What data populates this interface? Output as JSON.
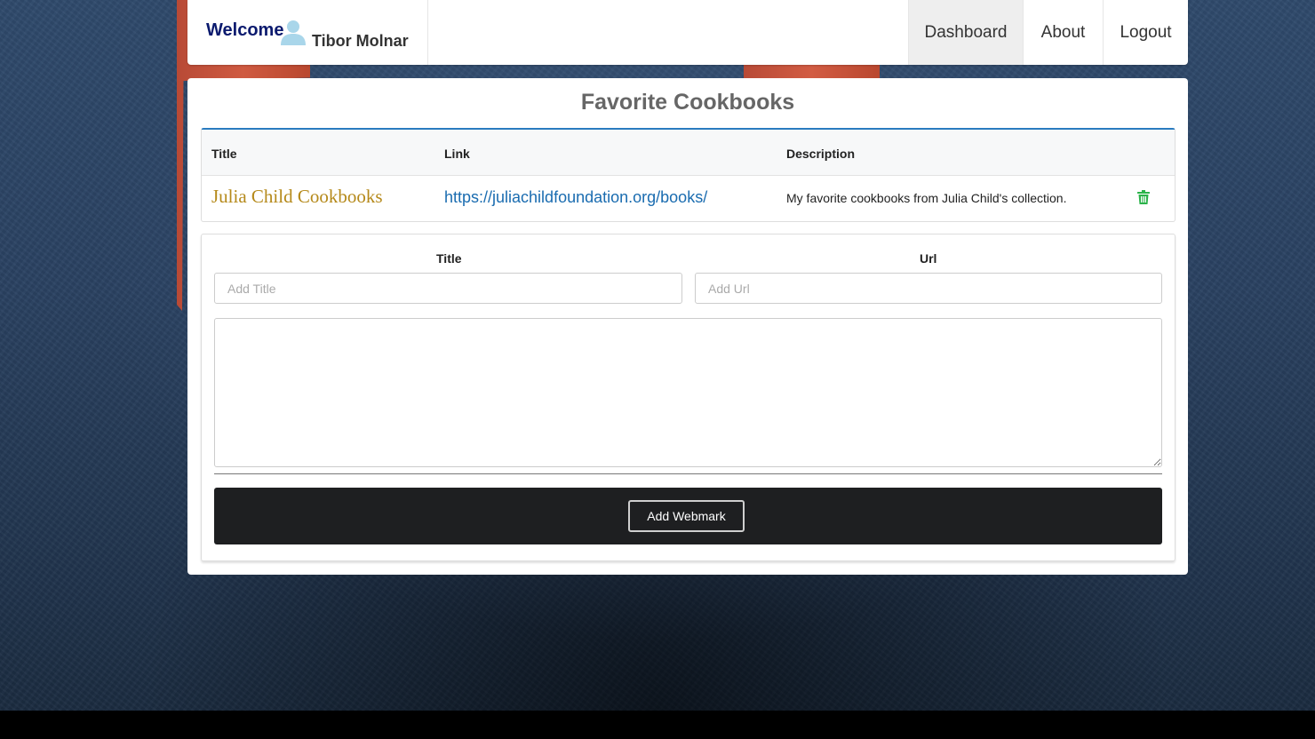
{
  "header": {
    "welcome": "Welcome",
    "username": "Tibor Molnar",
    "user_icon": "user-icon",
    "nav": [
      {
        "label": "Dashboard",
        "active": true
      },
      {
        "label": "About",
        "active": false
      },
      {
        "label": "Logout",
        "active": false
      }
    ]
  },
  "main": {
    "title": "Favorite Cookbooks",
    "table": {
      "columns": [
        "Title",
        "Link",
        "Description"
      ],
      "rows": [
        {
          "title": "Julia Child Cookbooks",
          "link": "https://juliachildfoundation.org/books/",
          "description": "My favorite cookbooks from Julia Child's collection.",
          "action_icon": "trash-icon"
        }
      ]
    },
    "form": {
      "title_label": "Title",
      "title_placeholder": "Add Title",
      "url_label": "Url",
      "url_placeholder": "Add Url",
      "description_value": "",
      "submit_label": "Add Webmark"
    }
  },
  "colors": {
    "brand_welcome": "#0b1a6e",
    "title_gold": "#b5891a",
    "link_blue": "#1a6cb0",
    "delete_green": "#2bb34a",
    "accent_border": "#2a7bbf"
  }
}
